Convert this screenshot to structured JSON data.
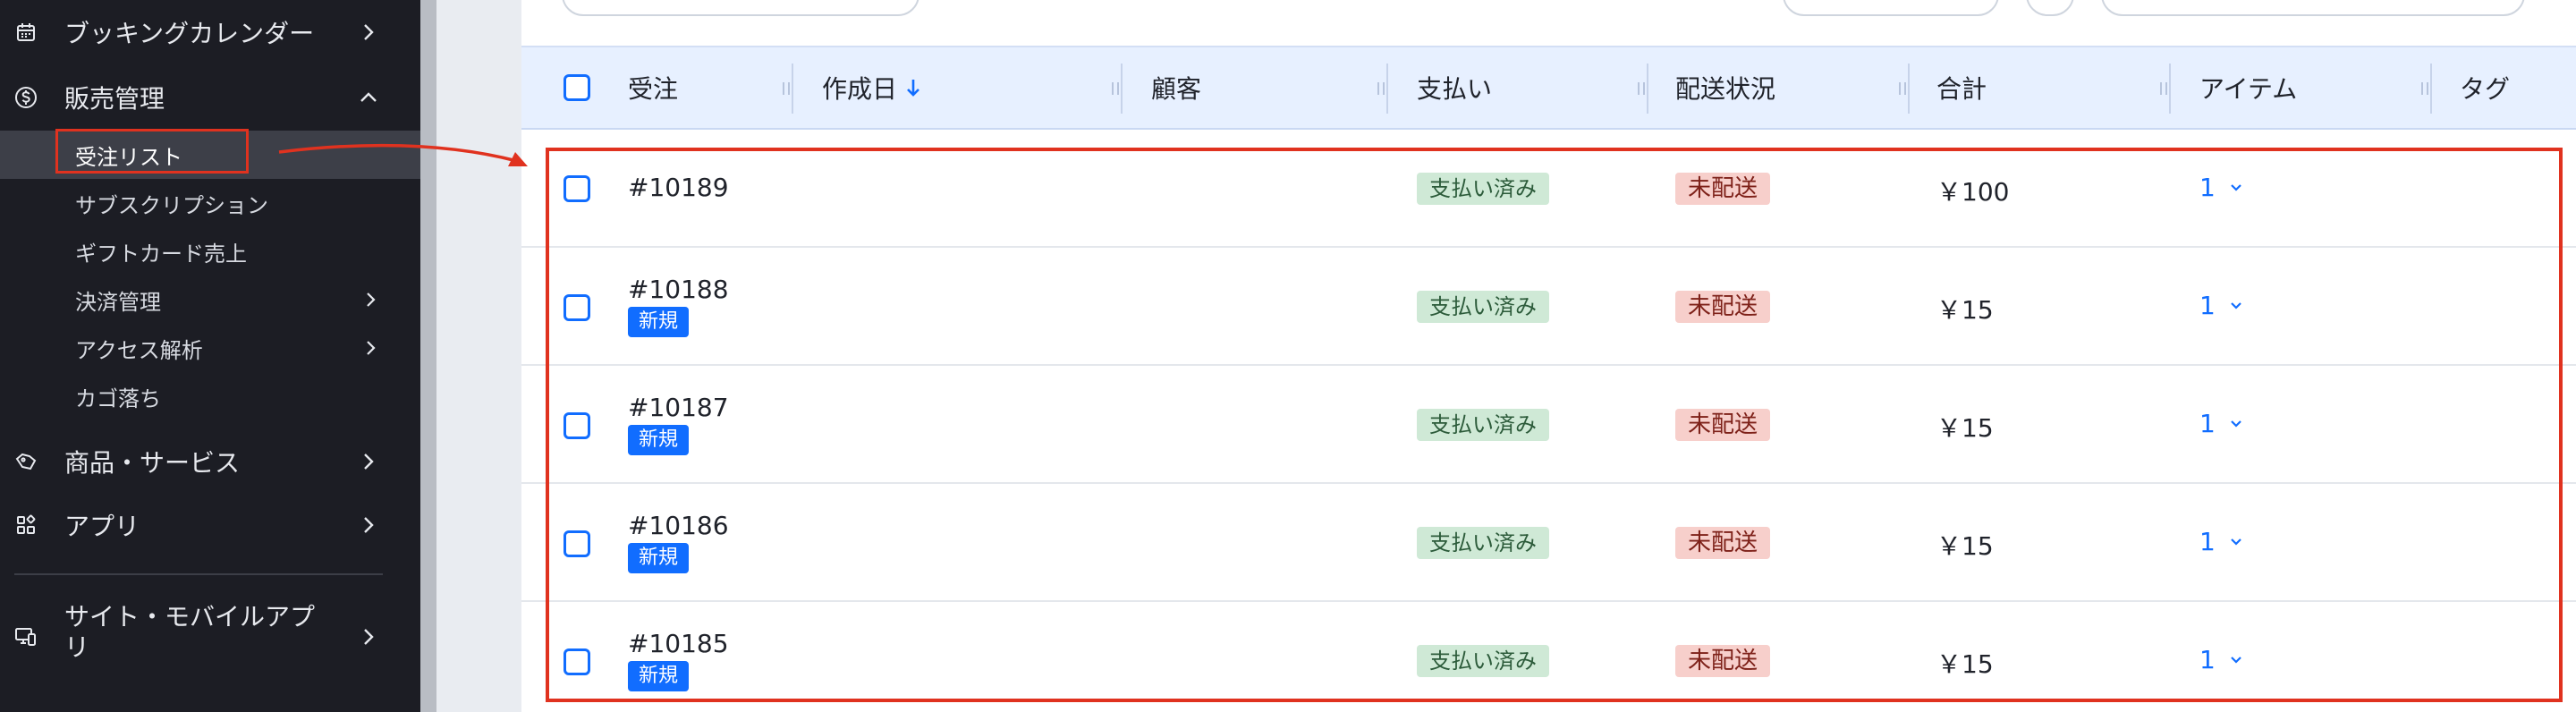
{
  "sidebar": {
    "items": [
      {
        "label": "ブッキングカレンダー",
        "icon": "calendar-icon"
      },
      {
        "label": "販売管理",
        "icon": "dollar-circle-icon"
      },
      {
        "label": "商品・サービス",
        "icon": "tag-icon"
      },
      {
        "label": "アプリ",
        "icon": "apps-icon"
      },
      {
        "label": "サイト・モバイルアプリ",
        "icon": "devices-icon"
      }
    ],
    "sales_sub_items": [
      {
        "label": "受注リスト"
      },
      {
        "label": "サブスクリプション"
      },
      {
        "label": "ギフトカード売上"
      },
      {
        "label": "決済管理"
      },
      {
        "label": "アクセス解析"
      },
      {
        "label": "カゴ落ち"
      }
    ]
  },
  "table": {
    "columns": [
      "受注",
      "作成日",
      "顧客",
      "支払い",
      "配送状況",
      "合計",
      "アイテム",
      "タグ"
    ],
    "rows": [
      {
        "order": "#10189",
        "is_new": false,
        "badge": "",
        "payment": "支払い済み",
        "shipping": "未配送",
        "total": "￥100",
        "items": "1"
      },
      {
        "order": "#10188",
        "is_new": true,
        "badge": "新規",
        "payment": "支払い済み",
        "shipping": "未配送",
        "total": "￥15",
        "items": "1"
      },
      {
        "order": "#10187",
        "is_new": true,
        "badge": "新規",
        "payment": "支払い済み",
        "shipping": "未配送",
        "total": "￥15",
        "items": "1"
      },
      {
        "order": "#10186",
        "is_new": true,
        "badge": "新規",
        "payment": "支払い済み",
        "shipping": "未配送",
        "total": "￥15",
        "items": "1"
      },
      {
        "order": "#10185",
        "is_new": true,
        "badge": "新規",
        "payment": "支払い済み",
        "shipping": "未配送",
        "total": "￥15",
        "items": "1"
      }
    ]
  },
  "colors": {
    "accent": "#116dff",
    "highlight": "#e0321f",
    "paid_bg": "#cfe9d6",
    "unshipped_bg": "#f7cfcb",
    "sidebar_bg": "#1c1d24",
    "header_bg": "#e7f0ff"
  }
}
